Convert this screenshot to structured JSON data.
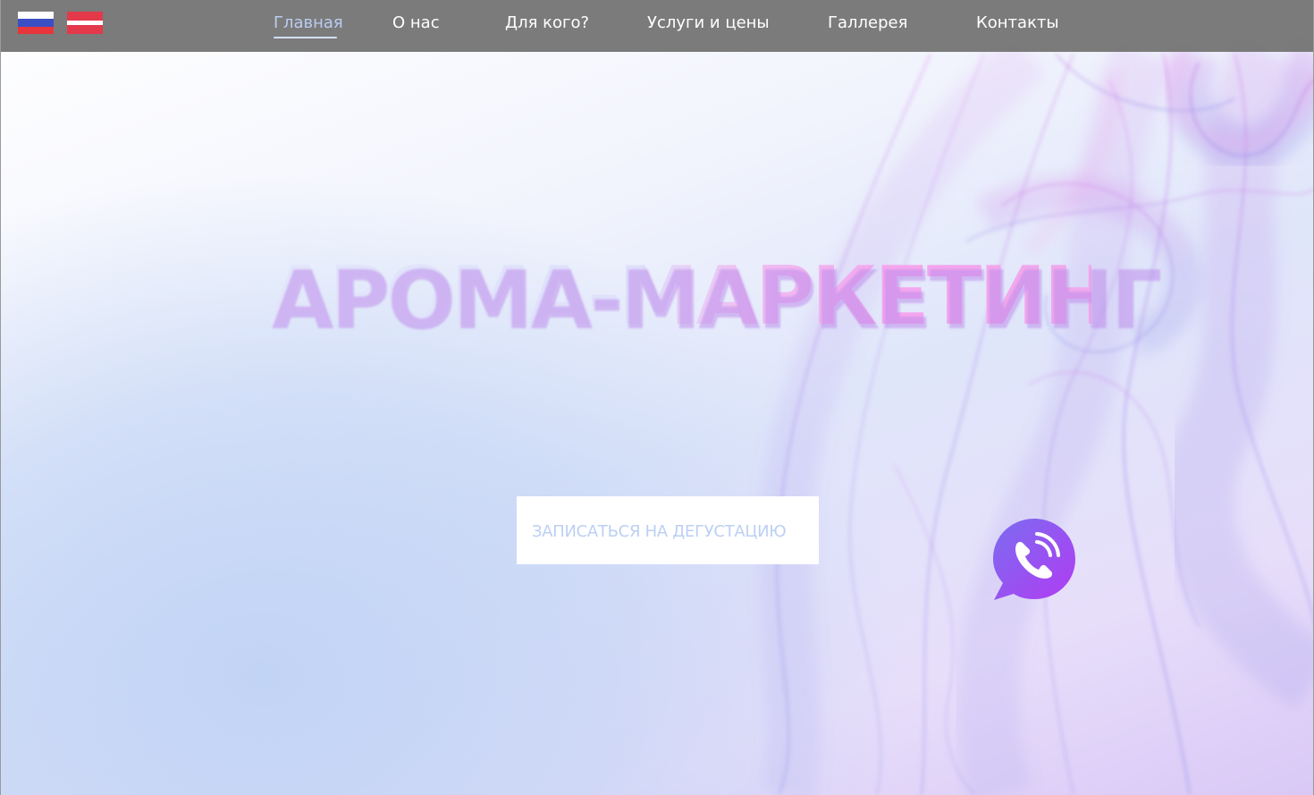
{
  "languages": [
    {
      "code": "ru",
      "label": "Русский"
    },
    {
      "code": "lv",
      "label": "Latviešu"
    }
  ],
  "nav": {
    "items": [
      {
        "label": "Главная",
        "active": true
      },
      {
        "label": "О нас",
        "active": false
      },
      {
        "label": "Для кого?",
        "active": false
      },
      {
        "label": "Услуги и цены",
        "active": false
      },
      {
        "label": "Галлерея",
        "active": false
      },
      {
        "label": "Контакты",
        "active": false
      }
    ]
  },
  "hero": {
    "title": "АРОМА-МАРКЕТИНГ",
    "cta_label": "ЗАПИСАТЬСЯ НА ДЕГУСТАЦИЮ"
  },
  "contact_widget": {
    "icon": "viber-phone-icon"
  },
  "colors": {
    "nav_bg": "#767676",
    "nav_text": "#ffffff",
    "nav_active": "#b9cdf3",
    "title_gradient_start": "#e3e6fb",
    "title_gradient_end": "#f4a6ee",
    "cta_text": "#bcd0f3",
    "viber_start": "#7b6cf0",
    "viber_end": "#b13cf2"
  }
}
